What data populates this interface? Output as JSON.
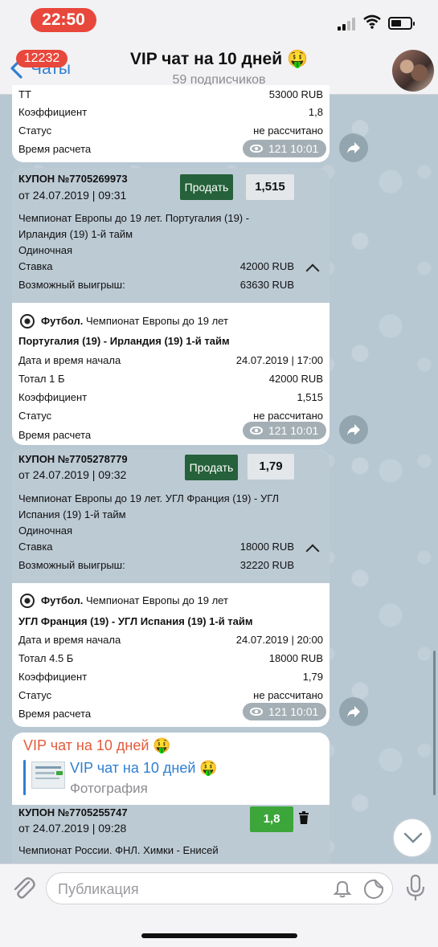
{
  "status": {
    "time": "22:50"
  },
  "header": {
    "back_label": "Чаты",
    "unread_badge": "12232",
    "title": "VIP чат на 10 дней 🤑",
    "subtitle": "59 подписчиков"
  },
  "bubble0": {
    "cut_row": {
      "k": "ТТ",
      "v": "53000 RUB"
    },
    "rows": [
      {
        "k": "Коэффициент",
        "v": "1,8"
      },
      {
        "k": "Статус",
        "v": "не рассчитано"
      },
      {
        "k": "Время расчета",
        "v": ""
      }
    ],
    "views": "121",
    "time": "10:01"
  },
  "coupon1": {
    "title": "КУПОН №7705269973",
    "date": "от 24.07.2019 | 09:31",
    "sell_label": "Продать",
    "odds": "1,515",
    "event_line1": "Чемпионат Европы до 19 лет. Португалия (19) -",
    "event_line2": "Ирландия (19) 1-й тайм",
    "bet_type": "Одиночная",
    "stake_label": "Ставка",
    "stake_value": "42000 RUB",
    "win_label": "Возможный выигрыш:",
    "win_value": "63630 RUB",
    "sport": "Футбол.",
    "league": "Чемпионат Европы до 19 лет",
    "match": "Португалия (19) - Ирландия (19) 1-й тайм",
    "details": [
      {
        "k": "Дата и время начала",
        "v": "24.07.2019 | 17:00"
      },
      {
        "k": "Тотал 1 Б",
        "v": "42000 RUB"
      },
      {
        "k": "Коэффициент",
        "v": "1,515"
      },
      {
        "k": "Статус",
        "v": "не рассчитано"
      },
      {
        "k": "Время расчета",
        "v": ""
      }
    ],
    "views": "121",
    "time": "10:01"
  },
  "coupon2": {
    "title": "КУПОН №7705278779",
    "date": "от 24.07.2019 | 09:32",
    "sell_label": "Продать",
    "odds": "1,79",
    "event_line1": "Чемпионат Европы до 19 лет. УГЛ Франция (19) - УГЛ",
    "event_line2": "Испания (19) 1-й тайм",
    "bet_type": "Одиночная",
    "stake_label": "Ставка",
    "stake_value": "18000 RUB",
    "win_label": "Возможный выигрыш:",
    "win_value": "32220 RUB",
    "sport": "Футбол.",
    "league": "Чемпионат Европы до 19 лет",
    "match": "УГЛ Франция (19) - УГЛ Испания (19) 1-й тайм",
    "details": [
      {
        "k": "Дата и время начала",
        "v": "24.07.2019 | 20:00"
      },
      {
        "k": "Тотал 4.5 Б",
        "v": "18000 RUB"
      },
      {
        "k": "Коэффициент",
        "v": "1,79"
      },
      {
        "k": "Статус",
        "v": "не рассчитано"
      },
      {
        "k": "Время расчета",
        "v": ""
      }
    ],
    "views": "121",
    "time": "10:01"
  },
  "forward": {
    "sender": "VIP чат на 10 дней 🤑",
    "reply_title": "VIP чат на 10 дней 🤑",
    "reply_sub": "Фотография"
  },
  "coupon3": {
    "title": "КУПОН №7705255747",
    "date": "от 24.07.2019 | 09:28",
    "odds": "1,8",
    "event_line1": "Чемпионат России. ФНЛ. Химки - Енисей"
  },
  "input": {
    "placeholder": "Публикация"
  },
  "colors": {
    "accent": "#2f7fd1",
    "sell_green": "#25613a",
    "odds_green": "#3ca63a",
    "badge_red": "#e8473b"
  }
}
